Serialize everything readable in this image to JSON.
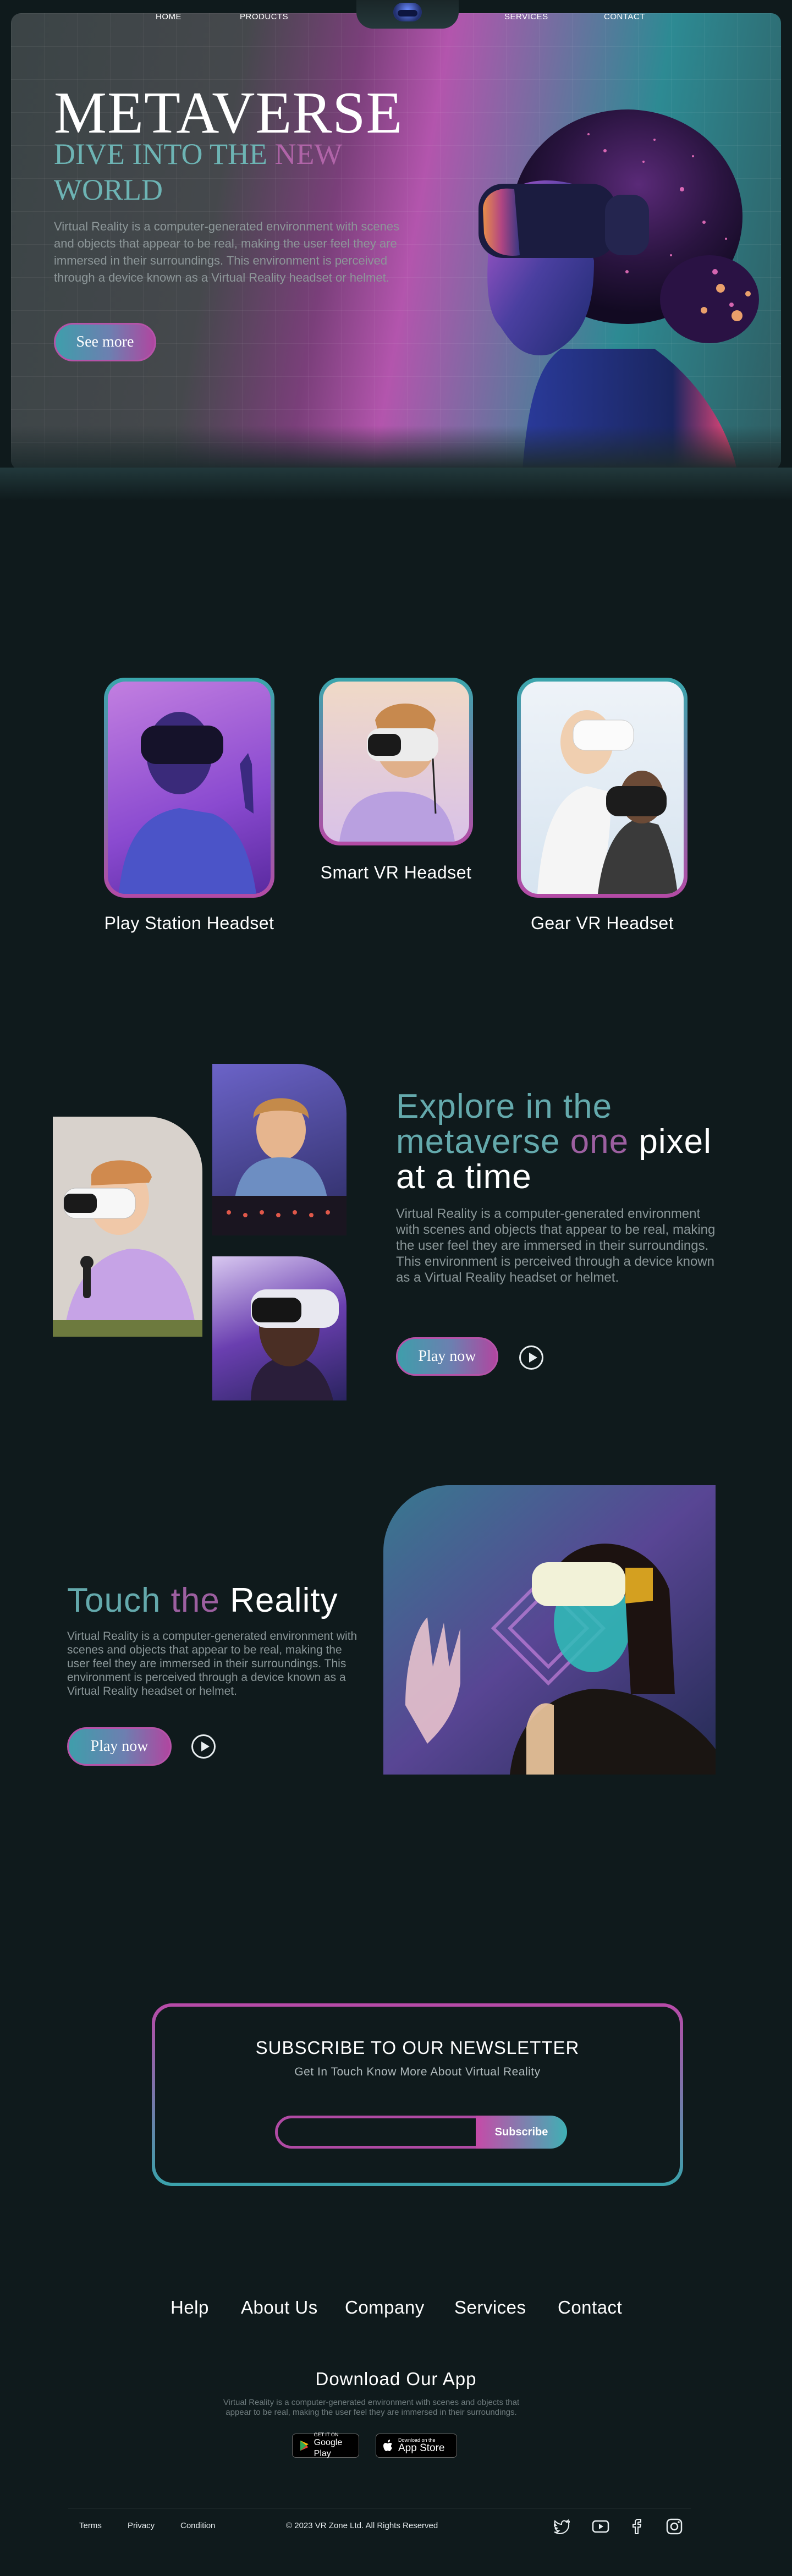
{
  "nav": {
    "items": [
      "HOME",
      "PRODUCTS",
      "SERVICES",
      "CONTACT"
    ]
  },
  "hero": {
    "title": "METAVERSE",
    "subtitle_part1": "DIVE INTO THE ",
    "subtitle_part2": "NEW",
    "subtitle_line2": "WORLD",
    "description": "Virtual Reality is a computer-generated environment with scenes and objects that appear to be real, making the user feel they are immersed in their surroundings. This environment is perceived through a device known as a Virtual Reality headset or helmet.",
    "button": "See more"
  },
  "products": [
    {
      "label": "Play Station Headset"
    },
    {
      "label": "Smart VR Headset"
    },
    {
      "label": "Gear VR Headset"
    }
  ],
  "explore": {
    "heading_teal1": "Explore in the",
    "heading_teal2": "metaverse",
    "heading_pink": " one",
    "heading_white": " pixel",
    "heading_line3": "at a time",
    "description": "Virtual Reality is a computer-generated environment with scenes and objects that appear to be real, making the user feel they are immersed in their surroundings. This environment is perceived through a device known as a Virtual Reality headset or helmet.",
    "button": "Play now"
  },
  "touch": {
    "heading_teal": "Touch",
    "heading_pink": " the",
    "heading_white": " Reality",
    "description": "Virtual Reality is a computer-generated environment with scenes and objects that appear to be real, making the user feel they are immersed in their surroundings. This environment is perceived through a device known as a Virtual Reality headset or helmet.",
    "button": "Play now"
  },
  "newsletter": {
    "title": "SUBSCRIBE TO OUR NEWSLETTER",
    "subtitle": "Get In Touch Know More About Virtual Reality",
    "input_value": "",
    "button": "Subscribe"
  },
  "footer": {
    "nav": [
      "Help",
      "About Us",
      "Company",
      "Services",
      "Contact"
    ],
    "download_title": "Download Our App",
    "download_desc": "Virtual Reality is a computer-generated environment with scenes and objects that appear to be real, making the user feel they are immersed in their surroundings.",
    "google_small": "GET IT ON",
    "google_big": "Google Play",
    "apple_small": "Download on the",
    "apple_big": "App Store",
    "links": [
      "Terms",
      "Privacy",
      "Condition"
    ],
    "copyright": "2023 VR Zone Ltd. All Rights Reserved",
    "social_icons": [
      "twitter-icon",
      "youtube-icon",
      "facebook-icon",
      "instagram-icon"
    ]
  },
  "colors": {
    "teal": "#64a9ac",
    "pink": "#b04aa4",
    "background": "#0f1a1c"
  }
}
